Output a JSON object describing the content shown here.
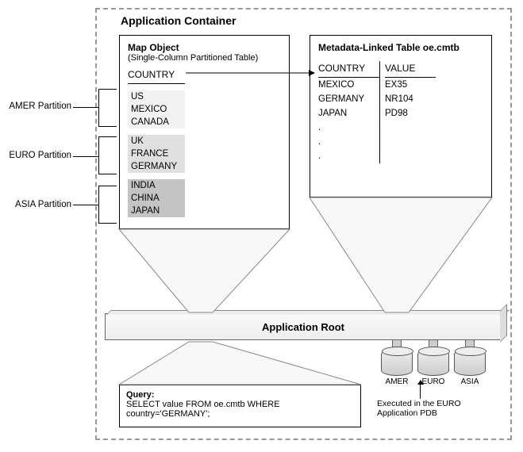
{
  "container_title": "Application Container",
  "map": {
    "title": "Map Object",
    "subtitle": "(Single-Column Partitioned Table)",
    "column": "COUNTRY",
    "partitions": [
      {
        "label": "AMER Partition",
        "rows": [
          "US",
          "MEXICO",
          "CANADA"
        ]
      },
      {
        "label": "EURO Partition",
        "rows": [
          "UK",
          "FRANCE",
          "GERMANY"
        ]
      },
      {
        "label": "ASIA Partition",
        "rows": [
          "INDIA",
          "CHINA",
          "JAPAN"
        ]
      }
    ]
  },
  "meta": {
    "title": "Metadata-Linked Table oe.cmtb",
    "col1": "COUNTRY",
    "col2": "VALUE",
    "rows": [
      {
        "c": "MEXICO",
        "v": "EX35"
      },
      {
        "c": "GERMANY",
        "v": "NR104"
      },
      {
        "c": "JAPAN",
        "v": "PD98"
      },
      {
        "c": ".",
        "v": ""
      },
      {
        "c": ".",
        "v": ""
      },
      {
        "c": ".",
        "v": ""
      }
    ]
  },
  "root_label": "Application Root",
  "pdbs": [
    "AMER",
    "EURO",
    "ASIA"
  ],
  "query": {
    "title": "Query:",
    "text": "SELECT value FROM oe.cmtb WHERE country='GERMANY';"
  },
  "exec_note": "Executed in the EURO Application PDB"
}
